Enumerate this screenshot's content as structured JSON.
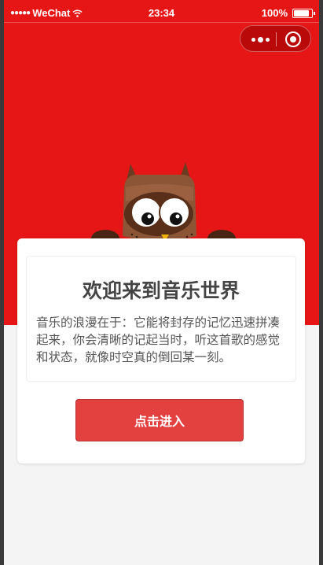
{
  "status_bar": {
    "signal_dots": "●●●●●",
    "carrier": "WeChat",
    "wifi_icon": "wifi-icon",
    "time": "23:34",
    "battery_percent": "100%",
    "battery_level": 1.0
  },
  "capsule": {
    "more_icon": "more-dots-icon",
    "close_icon": "close-circle-icon"
  },
  "card": {
    "title": "欢迎来到音乐世界",
    "body": "音乐的浪漫在于：它能将封存的记忆迅速拼凑起来，你会清晰的记起当时，听这首歌的感觉和状态，就像时空真的倒回某一刻。",
    "button_label": "点击进入"
  },
  "colors": {
    "header_red": "#e61616",
    "button_red": "#e34040",
    "page_bg": "#f4f4f4"
  },
  "mascot": {
    "icon": "owl-mascot-icon"
  }
}
